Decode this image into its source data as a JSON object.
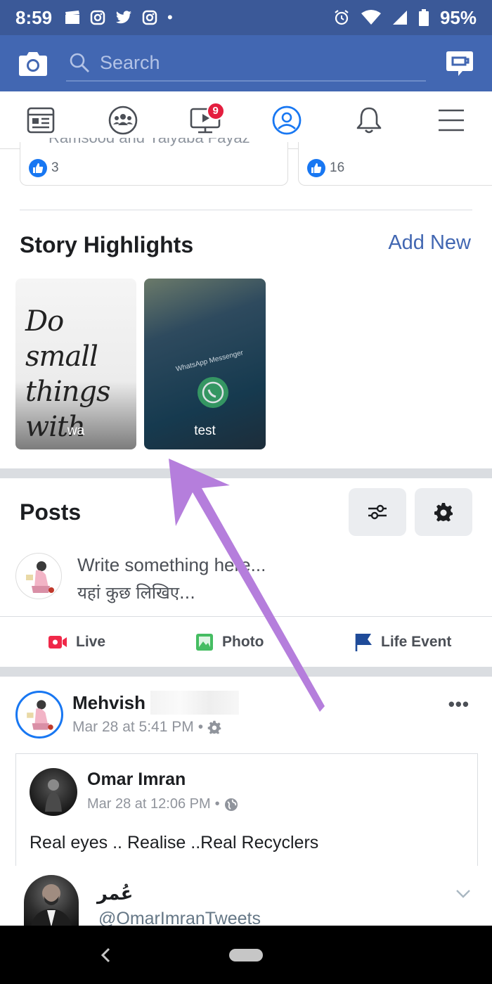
{
  "status_bar": {
    "time": "8:59",
    "battery": "95%"
  },
  "top_bar": {
    "search_placeholder": "Search"
  },
  "tabs": {
    "watch_badge": "9"
  },
  "previous_cards": {
    "left_likes": "3",
    "right_likes": "16",
    "left_clipped_text": "Ramsood and Yaiyaba Fayaz"
  },
  "story_highlights": {
    "title": "Story Highlights",
    "add_new": "Add New",
    "items": [
      {
        "label": "wa",
        "image_text": "Do small things with GREAT love."
      },
      {
        "label": "test",
        "image_text": "WhatsApp Messenger"
      }
    ]
  },
  "posts": {
    "title": "Posts",
    "composer_line1": "Write something here...",
    "composer_line2": "यहां कुछ लिखिए...",
    "actions": {
      "live": "Live",
      "photo": "Photo",
      "life_event": "Life Event"
    }
  },
  "feed_post": {
    "author": "Mehvish",
    "timestamp": "Mar 28 at 5:41 PM",
    "shared": {
      "author": "Omar Imran",
      "timestamp": "Mar 28 at 12:06 PM",
      "text": "Real eyes  .. Realise ..Real Recyclers"
    },
    "embed": {
      "name": "عُمر",
      "handle": "@OmarImranTweets"
    }
  },
  "colors": {
    "facebook_blue": "#4267b2",
    "status_bar": "#3b5998",
    "link_blue": "#4267b2",
    "badge_red": "#e41e3f",
    "annotation_arrow": "#b57edc"
  }
}
